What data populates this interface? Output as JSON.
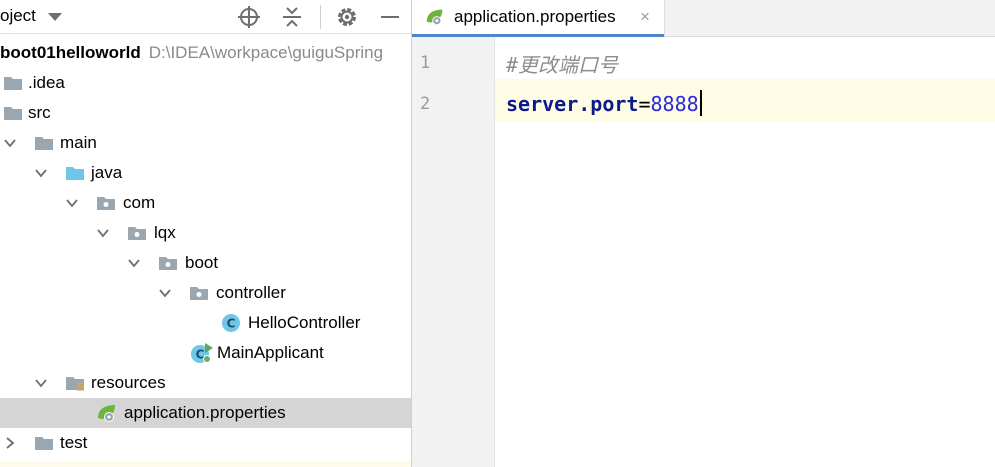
{
  "project_panel": {
    "title": "oject",
    "tree": [
      {
        "label": "boot01helloworld",
        "path": "D:\\IDEA\\workpace\\guiguSpring",
        "icon": "module-folder-icon",
        "expanded": true
      },
      {
        "label": ".idea",
        "icon": "folder-icon"
      },
      {
        "label": "src",
        "icon": "folder-icon"
      },
      {
        "label": "main",
        "icon": "folder-icon",
        "expanded": true
      },
      {
        "label": "java",
        "icon": "source-folder-icon",
        "expanded": true
      },
      {
        "label": "com",
        "icon": "package-icon",
        "expanded": true
      },
      {
        "label": "lqx",
        "icon": "package-icon",
        "expanded": true
      },
      {
        "label": "boot",
        "icon": "package-icon",
        "expanded": true
      },
      {
        "label": "controller",
        "icon": "package-icon",
        "expanded": true
      },
      {
        "label": "HelloController",
        "icon": "java-class-icon"
      },
      {
        "label": "MainApplicant",
        "icon": "spring-boot-class-icon"
      },
      {
        "label": "resources",
        "icon": "resources-folder-icon",
        "expanded": true
      },
      {
        "label": "application.properties",
        "icon": "spring-properties-icon",
        "selected": true
      },
      {
        "label": "test",
        "icon": "folder-icon",
        "expanded": false
      }
    ]
  },
  "editor": {
    "tab": {
      "label": "application.properties",
      "close": "×"
    },
    "lines": [
      {
        "number": "1",
        "comment": "#更改端口号"
      },
      {
        "number": "2",
        "key": "server.port",
        "eq": "=",
        "value": "8888"
      }
    ]
  },
  "colors": {
    "accent": "#4a87c9",
    "selection": "#d5d5d5",
    "current_line": "#fefce5",
    "keyword": "#0d1a8c",
    "number": "#2b2bdd"
  }
}
